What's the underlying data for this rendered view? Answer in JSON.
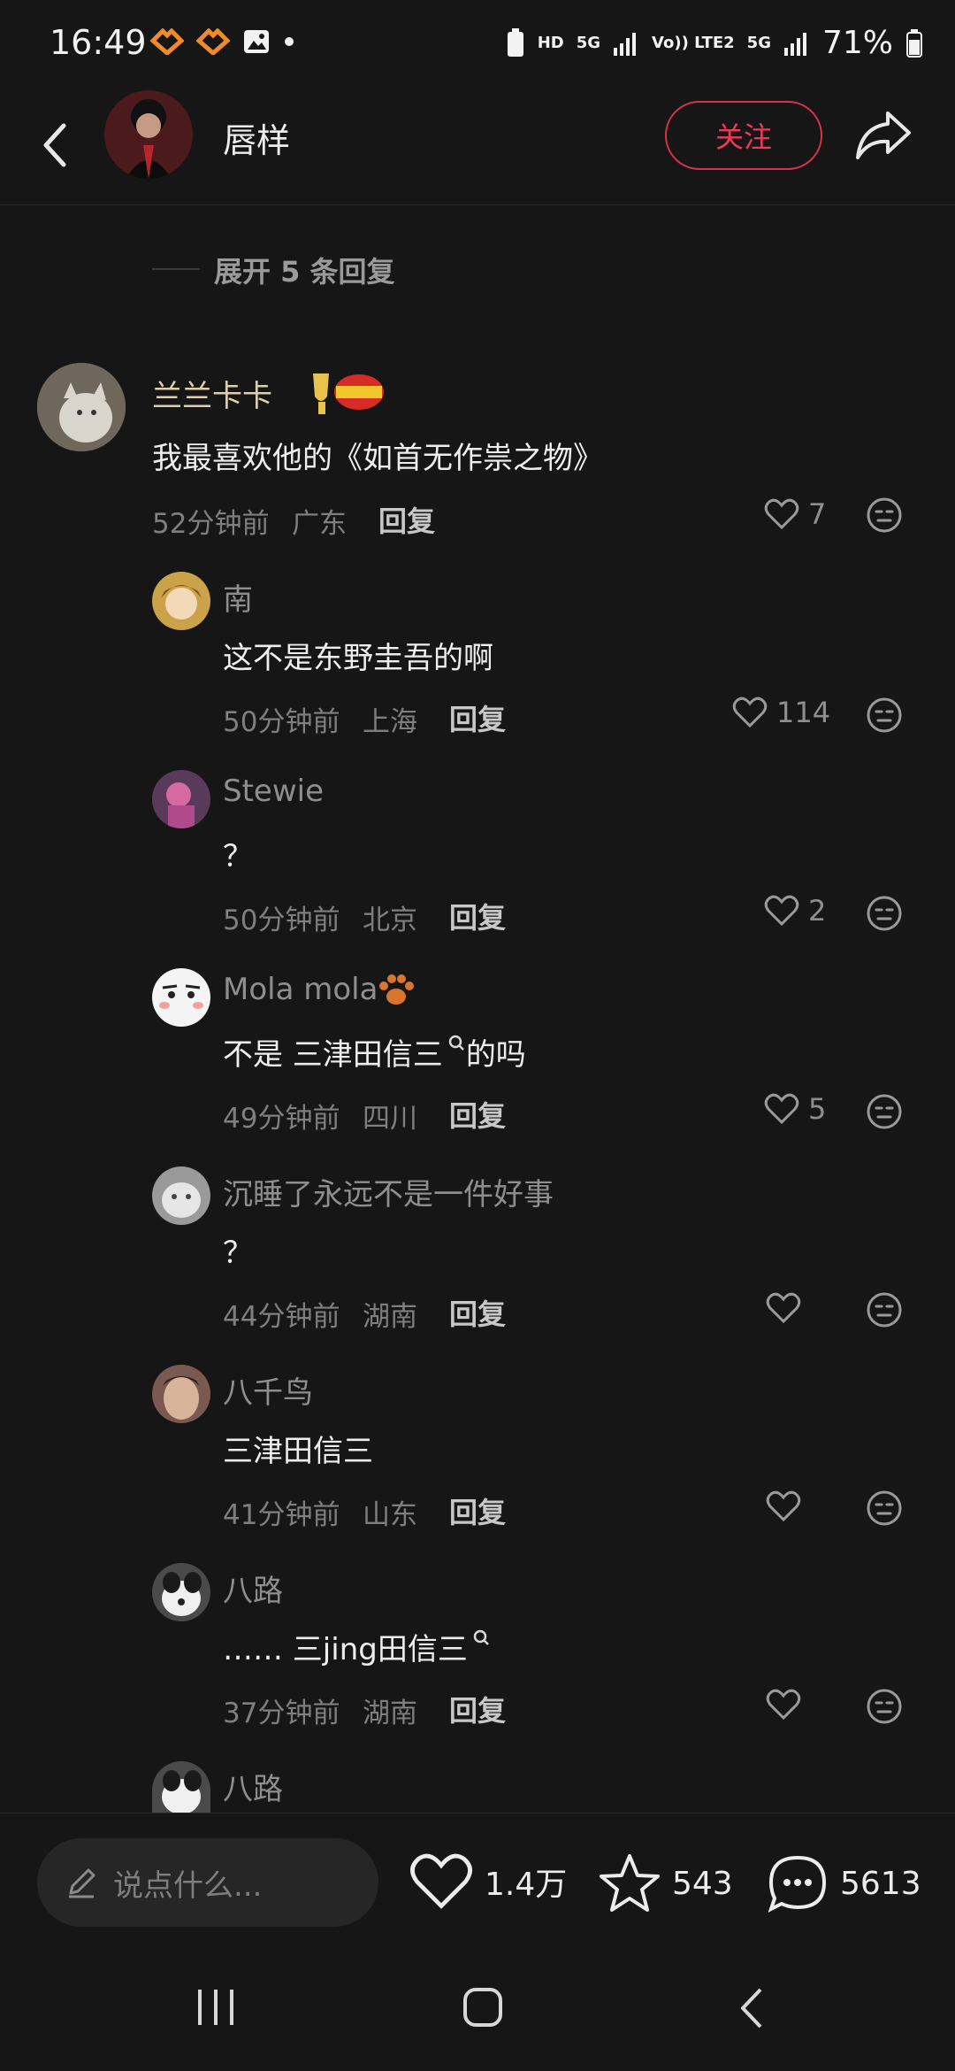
{
  "status": {
    "time": "16:49",
    "hd": "HD",
    "net1": "5G",
    "volte": "Vo)) LTE2",
    "net2": "5G",
    "battery": "71%"
  },
  "header": {
    "author_name": "唇样",
    "follow_label": "关注"
  },
  "expand": {
    "label": "展开 5 条回复"
  },
  "main_comment": {
    "name": "兰兰卡卡",
    "text": "我最喜欢他的《如首无作祟之物》",
    "time": "52分钟前",
    "location": "广东",
    "reply_label": "回复",
    "likes": "7"
  },
  "replies": [
    {
      "name": "南",
      "text": "这不是东野圭吾的啊",
      "time": "50分钟前",
      "location": "上海",
      "reply_label": "回复",
      "likes": "114"
    },
    {
      "name": "Stewie",
      "text": "？",
      "time": "50分钟前",
      "location": "北京",
      "reply_label": "回复",
      "likes": "2"
    },
    {
      "name": "Mola mola",
      "text": "不是 三津田信三",
      "text_suffix": " 的吗",
      "time": "49分钟前",
      "location": "四川",
      "reply_label": "回复",
      "likes": "5"
    },
    {
      "name": "沉睡了永远不是一件好事",
      "text": "？",
      "time": "44分钟前",
      "location": "湖南",
      "reply_label": "回复",
      "likes": ""
    },
    {
      "name": "八千鸟",
      "text": "三津田信三",
      "time": "41分钟前",
      "location": "山东",
      "reply_label": "回复",
      "likes": ""
    },
    {
      "name": "八路",
      "text": "…… 三jing田信三",
      "time": "37分钟前",
      "location": "湖南",
      "reply_label": "回复",
      "likes": ""
    },
    {
      "name": "八路"
    }
  ],
  "bottom": {
    "input_placeholder": "说点什么...",
    "likes": "1.4万",
    "stars": "543",
    "comments": "5613"
  },
  "colors": {
    "background": "#161616",
    "accent_red": "#f03a55",
    "main_name": "#e3cfa7"
  }
}
